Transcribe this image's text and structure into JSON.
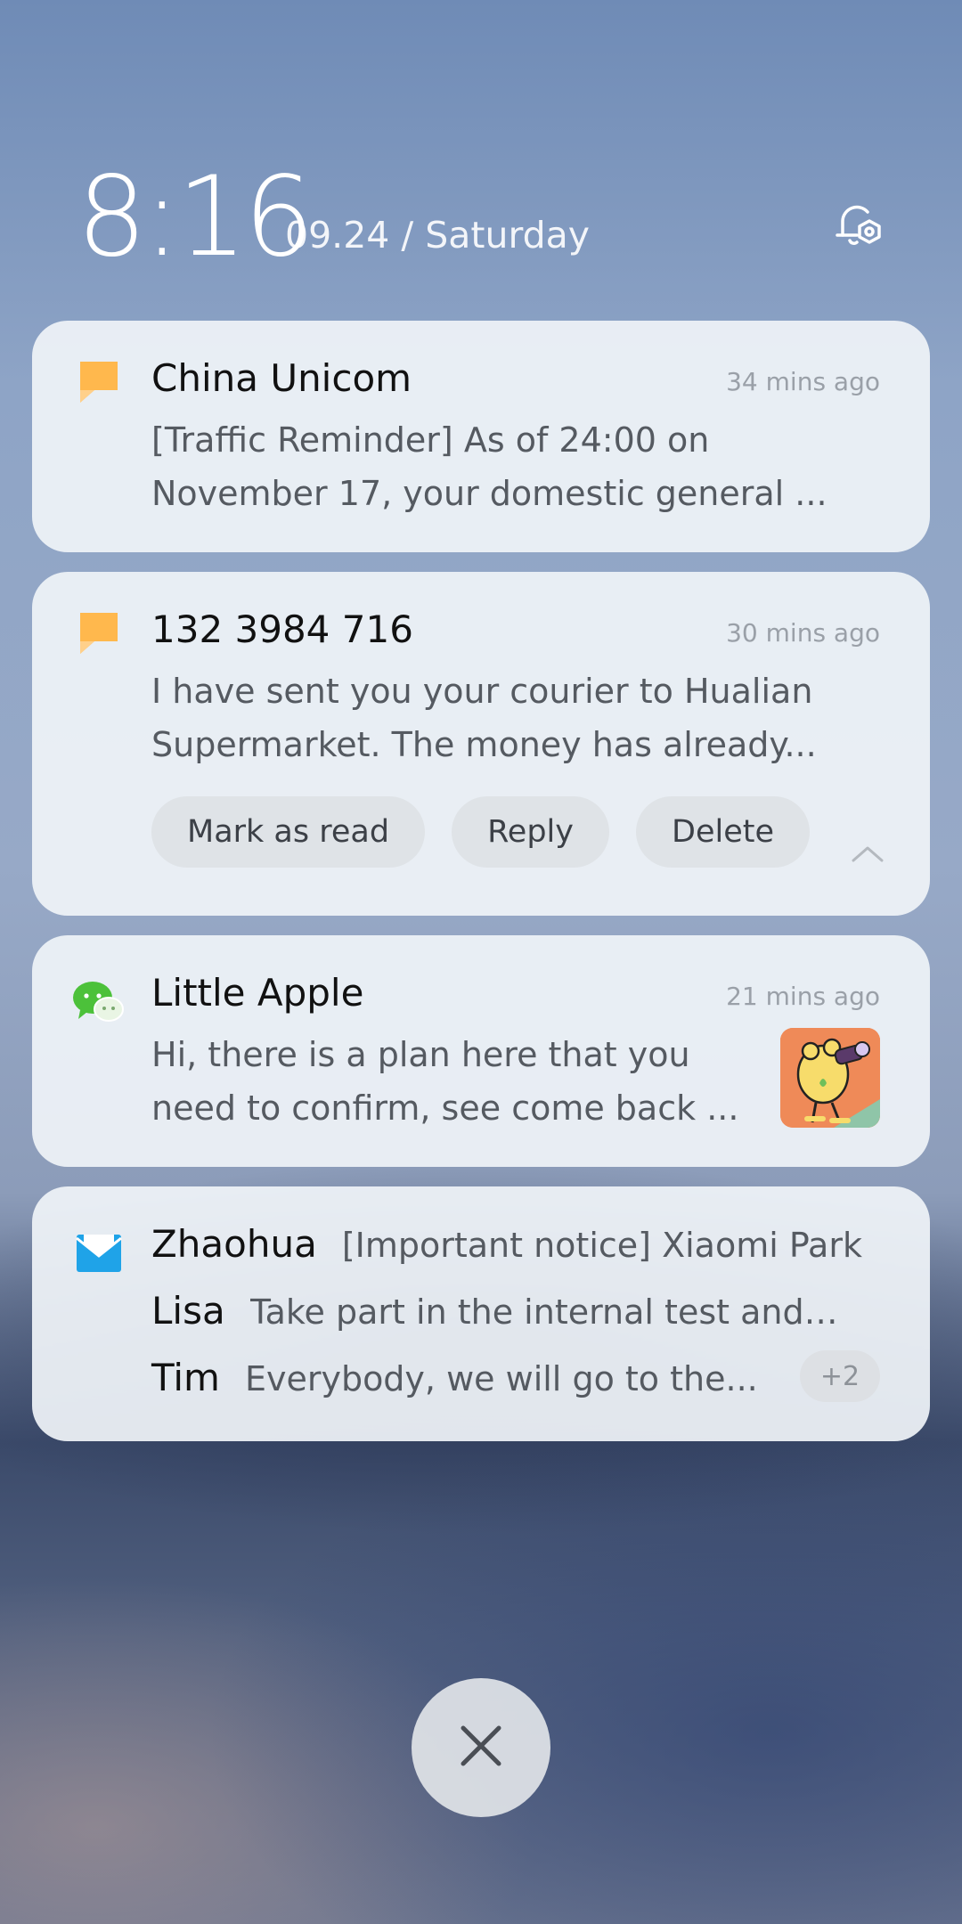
{
  "lockscreen": {
    "time": "8:16",
    "date": "09.24 / Saturday",
    "settings_icon": "bell-settings-icon"
  },
  "notifications": [
    {
      "app_icon": "message-icon",
      "title": "China Unicom",
      "time": "34 mins ago",
      "line1": "[Traffic Reminder] As of 24:00 on",
      "line2": "November 17, your domestic general ..."
    },
    {
      "app_icon": "message-icon",
      "title": "132 3984 716",
      "time": "30 mins ago",
      "line1": "I have sent you your courier to Hualian",
      "line2": "Supermarket. The money has already...",
      "actions": [
        "Mark as read",
        "Reply",
        "Delete"
      ],
      "collapse_icon": "chevron-up-icon"
    },
    {
      "app_icon": "wechat-icon",
      "title": "Little Apple",
      "time": "21 mins ago",
      "line1": "Hi, there is a plan here that you",
      "line2": "need to confirm, see come back ...",
      "thumbnail": "sticker-image"
    },
    {
      "app_icon": "mail-icon",
      "rows": [
        {
          "name": "Zhaohua",
          "text": "[Important notice] Xiaomi Park"
        },
        {
          "name": "Lisa",
          "text": "Take part in the internal test and ..."
        },
        {
          "name": "Tim",
          "text": "Everybody, we will go to the..."
        }
      ],
      "more_badge": "+2"
    }
  ],
  "close_button_icon": "close-icon",
  "colors": {
    "card_bg": "#eff3f7",
    "message_icon": "#ffb84d",
    "wechat_icon": "#4cc13a",
    "mail_icon": "#1fa3e8"
  }
}
